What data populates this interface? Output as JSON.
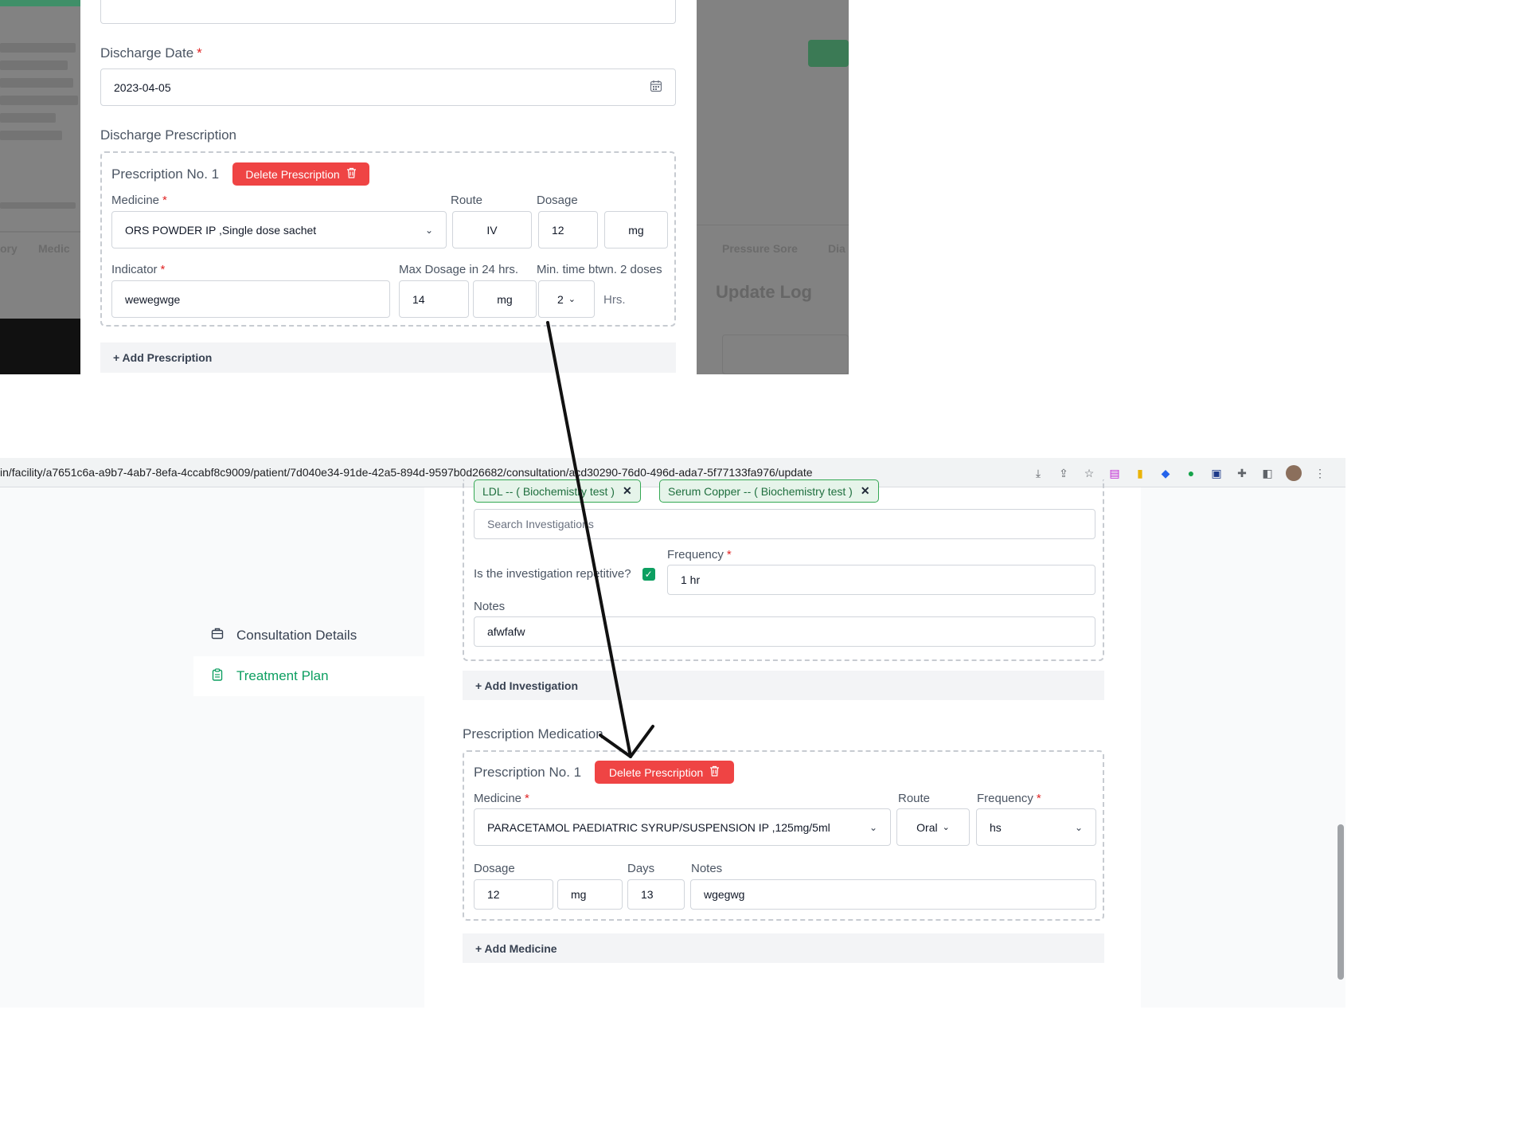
{
  "top": {
    "dimmed_labels": [
      "ory",
      "Medic",
      "Pressure Sore",
      "Dia"
    ],
    "update_log_heading": "Update Log",
    "discharge_date_label": "Discharge Date",
    "discharge_date_value": "2023-04-05",
    "discharge_prescription_label": "Discharge Prescription",
    "prescription_title": "Prescription No. 1",
    "delete_prescription_label": "Delete Prescription",
    "medicine_label": "Medicine",
    "medicine_value": "ORS POWDER IP ,Single dose sachet",
    "route_label": "Route",
    "route_value": "IV",
    "dosage_label": "Dosage",
    "dosage_value": "12",
    "dosage_unit": "mg",
    "indicator_label": "Indicator",
    "indicator_value": "wewegwge",
    "max_dosage_label": "Max Dosage in 24 hrs.",
    "max_dosage_value": "14",
    "max_dosage_unit": "mg",
    "min_time_label": "Min. time btwn. 2 doses",
    "min_time_value": "2",
    "min_time_unit": "Hrs.",
    "add_prescription_label": "+ Add Prescription",
    "required_mark": "*"
  },
  "browser": {
    "url": "in/facility/a7651c6a-a9b7-4ab7-8efa-4ccabf8c9009/patient/7d040e34-91de-42a5-894d-9597b0d26682/consultation/acd30290-76d0-496d-ada7-5f77133fa976/update",
    "icons": [
      "install-icon",
      "share-icon",
      "star-icon",
      "extension-1-icon",
      "extension-2-icon",
      "extension-3-icon",
      "grammarly-icon",
      "extension-5-icon",
      "puzzle-icon",
      "sidepanel-icon",
      "profile-avatar",
      "menu-dots-icon"
    ]
  },
  "sidebar": {
    "items": [
      {
        "label": "Consultation Details",
        "active": false
      },
      {
        "label": "Treatment Plan",
        "active": true
      }
    ]
  },
  "investigations": {
    "chips": [
      "LDL -- ( Biochemistry test )",
      "Serum Copper -- ( Biochemistry test )"
    ],
    "search_placeholder": "Search Investigations",
    "repetitive_label": "Is the investigation repetitive?",
    "repetitive_checked": true,
    "frequency_label": "Frequency",
    "frequency_value": "1 hr",
    "notes_label": "Notes",
    "notes_value": "afwfafw",
    "add_label": "+ Add Investigation"
  },
  "prescription_medication": {
    "section_label": "Prescription Medication",
    "title": "Prescription No. 1",
    "delete_label": "Delete Prescription",
    "medicine_label": "Medicine",
    "medicine_value": "PARACETAMOL PAEDIATRIC SYRUP/SUSPENSION IP ,125mg/5ml",
    "route_label": "Route",
    "route_value": "Oral",
    "frequency_label": "Frequency",
    "frequency_value": "hs",
    "dosage_label": "Dosage",
    "dosage_value": "12",
    "dosage_unit": "mg",
    "days_label": "Days",
    "days_value": "13",
    "notes_label": "Notes",
    "notes_value": "wgegwg",
    "add_label": "+ Add Medicine"
  },
  "colors": {
    "danger": "#ef4444",
    "accent_green": "#0d9f61",
    "chip_bg": "#e6f4ea"
  }
}
